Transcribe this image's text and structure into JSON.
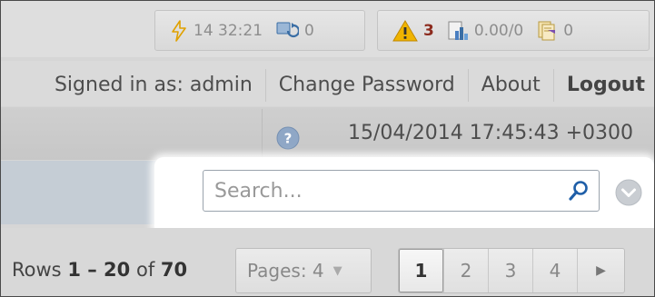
{
  "status_bar": {
    "time": "14 32:21",
    "sync_count": "0",
    "alerts_count": "3",
    "balance": "0.00/0",
    "docs_count": "0"
  },
  "user_bar": {
    "signed_in": "Signed in as: admin",
    "change_password": "Change Password",
    "about": "About",
    "logout": "Logout"
  },
  "datetime": "15/04/2014 17:45:43 +0300",
  "search": {
    "placeholder": "Search...",
    "value": ""
  },
  "pager": {
    "rows_prefix": "Rows",
    "rows_range": "1 – 20",
    "rows_of": "of",
    "rows_total": "70",
    "pages_label": "Pages: 4",
    "pages": [
      "1",
      "2",
      "3",
      "4"
    ],
    "current_page": "1",
    "next_symbol": "▶"
  },
  "icons": {
    "status": [
      "lightning-icon",
      "sync-icon",
      "warning-icon",
      "chart-icon",
      "documents-icon"
    ],
    "help": "help-icon",
    "search": "search-icon",
    "dropdown": "chevron-down-icon"
  },
  "colors": {
    "alert_text": "#8c2b1e",
    "warning_icon": "#e0a100",
    "sync_icon": "#3a6ea5",
    "chart_icon": "#4a7fc1",
    "highlight": "#ffffff"
  }
}
